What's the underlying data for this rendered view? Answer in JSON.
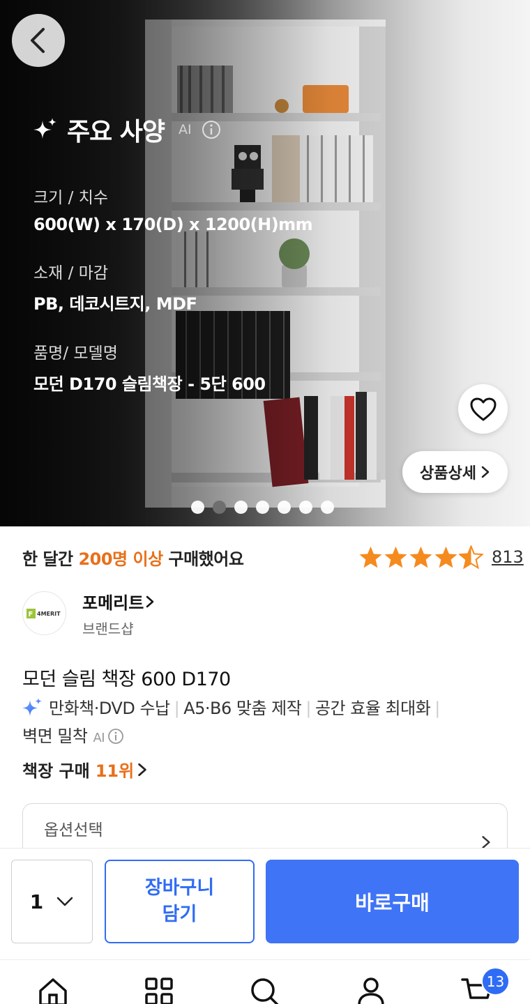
{
  "hero": {
    "spec_title": "주요 사양",
    "ai_label": "AI",
    "specs": [
      {
        "label": "크기 / 치수",
        "value": "600(W) x 170(D) x 1200(H)mm"
      },
      {
        "label": "소재 / 마감",
        "value": "PB, 데코시트지, MDF"
      },
      {
        "label": "품명/ 모델명",
        "value": "모던 D170 슬림책장 - 5단 600"
      }
    ],
    "detail_button": "상품상세",
    "slide_count": 7,
    "active_slide": 2
  },
  "summary": {
    "purchase_prefix": "한 달간 ",
    "purchase_highlight": "200명 이상",
    "purchase_suffix": " 구매했어요",
    "rating": 4.5,
    "review_count": "813"
  },
  "brand": {
    "logo_text": "4MERIT",
    "name": "포메리트",
    "sub": "브랜드샵"
  },
  "product": {
    "title": "모던 슬림 책장 600 D170",
    "features": [
      "만화책·DVD 수납",
      "A5·B6 맞춤 제작",
      "공간 효율 최대화",
      "벽면 밀착"
    ],
    "ai_label": "AI",
    "rank_prefix": "책장 구매",
    "rank_highlight": "11위"
  },
  "option": {
    "placeholder": "옵션선택"
  },
  "buy_bar": {
    "quantity": "1",
    "cart_label": "장바구니\n담기",
    "buy_label": "바로구매"
  },
  "nav": {
    "items": [
      "home-icon",
      "category-icon",
      "search-icon",
      "profile-icon",
      "cart-icon"
    ],
    "cart_badge": "13"
  },
  "colors": {
    "accent_blue": "#3f74f6",
    "highlight_orange": "#e8701a",
    "star_orange": "#f58a1f"
  }
}
